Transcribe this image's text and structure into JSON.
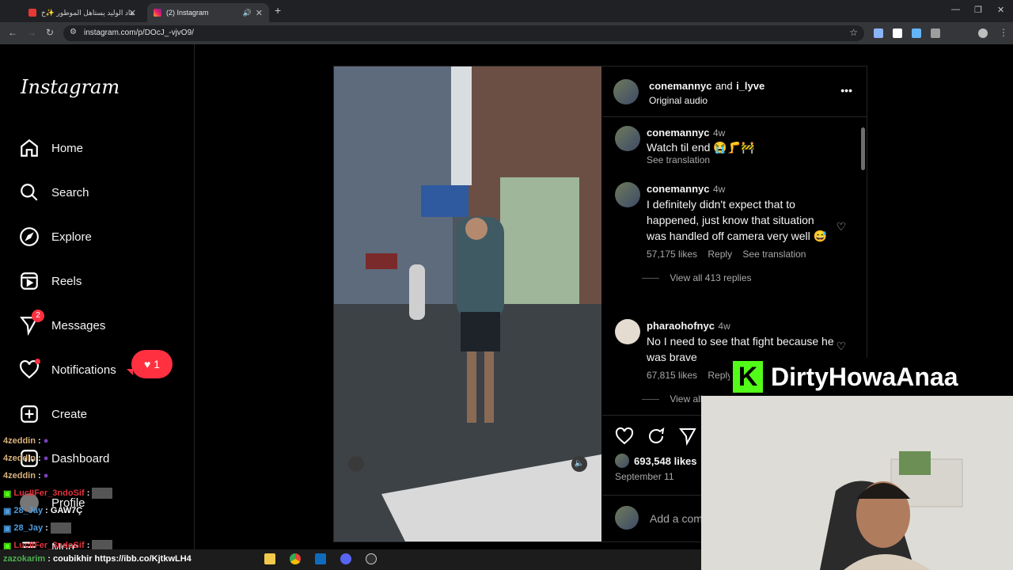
{
  "browser": {
    "tab1_title": "هاد الوليد يستاهل الموطور ✨خ",
    "tab2_title": "(2) Instagram",
    "url": "instagram.com/p/DOcJ_-vjvO9/"
  },
  "sidebar": {
    "logo": "Instagram",
    "items": [
      {
        "label": "Home",
        "icon": "home-icon"
      },
      {
        "label": "Search",
        "icon": "search-icon"
      },
      {
        "label": "Explore",
        "icon": "compass-icon"
      },
      {
        "label": "Reels",
        "icon": "reels-icon"
      },
      {
        "label": "Messages",
        "icon": "messages-icon"
      },
      {
        "label": "Notifications",
        "icon": "heart-icon"
      },
      {
        "label": "Create",
        "icon": "plus-icon"
      },
      {
        "label": "Dashboard",
        "icon": "dashboard-icon"
      },
      {
        "label": "Profile",
        "icon": "avatar-icon"
      },
      {
        "label": "More",
        "icon": "menu-icon"
      }
    ],
    "messages_badge": "2",
    "notifications_count": "1"
  },
  "post": {
    "header_user1": "conemannyc",
    "header_and": "and",
    "header_user2": "i_lyve",
    "audio": "Original audio",
    "more": "•••",
    "comments": [
      {
        "user": "conemannyc",
        "time": "4w",
        "text": "Watch til end 😭🦵🚧",
        "meta": "See translation"
      },
      {
        "user": "conemannyc",
        "time": "4w",
        "text": "I definitely didn't expect that to happened, just know that situation was handled off camera very well 😅",
        "likes": "57,175 likes",
        "reply": "Reply",
        "translate": "See translation",
        "view_replies": "View all 413 replies"
      },
      {
        "user": "pharaohofnyc",
        "time": "4w",
        "text": "No I need to see that fight because he was brave",
        "likes": "67,815 likes",
        "reply": "Reply",
        "view_replies": "View all"
      }
    ],
    "likes": "693,548 likes",
    "date": "September 11",
    "comment_placeholder": "Add a comment…"
  },
  "overlay": {
    "banner_k": "K",
    "banner_text": "DirtyHowaAnaa",
    "chat": [
      {
        "user": "4zeddin",
        "msg": "",
        "color": "#d9b27c"
      },
      {
        "user": "4zeddin",
        "msg": "",
        "color": "#d9b27c"
      },
      {
        "user": "4zeddin",
        "msg": "",
        "color": "#d9b27c"
      },
      {
        "user": "LucIIFer_3ndoSif",
        "msg": "",
        "color": "#e0323c"
      },
      {
        "user": "28_Jay",
        "msg": "GAW7Ç",
        "color": "#4d9de0"
      },
      {
        "user": "28_Jay",
        "msg": "",
        "color": "#4d9de0"
      },
      {
        "user": "LucIIFer_3ndoSif",
        "msg": "",
        "color": "#e0323c"
      },
      {
        "user": "zazokarim",
        "msg": "coubikhir https://ibb.co/KjtkwLH4",
        "color": "#4caf50"
      }
    ]
  }
}
